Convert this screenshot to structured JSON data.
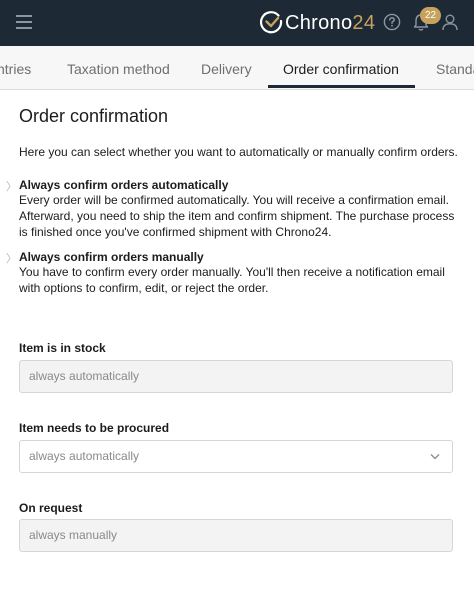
{
  "header": {
    "logo_text": "Chrono",
    "logo_number": "24",
    "notification_count": "22",
    "icons": [
      "menu-icon",
      "help-icon",
      "bell-icon",
      "user-icon"
    ]
  },
  "tabs": [
    {
      "label": "ntries",
      "active": false
    },
    {
      "label": "Taxation method",
      "active": false
    },
    {
      "label": "Delivery",
      "active": false
    },
    {
      "label": "Order confirmation",
      "active": true
    },
    {
      "label": "Standa",
      "active": false
    }
  ],
  "page": {
    "title": "Order confirmation",
    "intro": "Here you can select whether you want to automatically or manually confirm orders.",
    "options": [
      {
        "marker": "〉",
        "title": "Always confirm orders automatically",
        "desc": "Every order will be confirmed automatically.  You will receive a confirmation email. Afterward, you need to ship the item and confirm shipment. The purchase process is finished once you've confirmed shipment with Chrono24."
      },
      {
        "marker": "〉",
        "title": "Always confirm orders manually",
        "desc": "You have to confirm every order manually.  You'll then receive a notification email with options to confirm, edit, or reject the order."
      }
    ]
  },
  "fields": {
    "in_stock": {
      "label": "Item is in stock",
      "value": "always automatically"
    },
    "procured": {
      "label": "Item needs to be procured",
      "value": "always automatically"
    },
    "on_request": {
      "label": "On request",
      "value": "always manually"
    }
  },
  "colors": {
    "header_bg": "#1d2a35",
    "accent_gold": "#c6a25d",
    "active_tab_underline": "#1d2a35"
  }
}
